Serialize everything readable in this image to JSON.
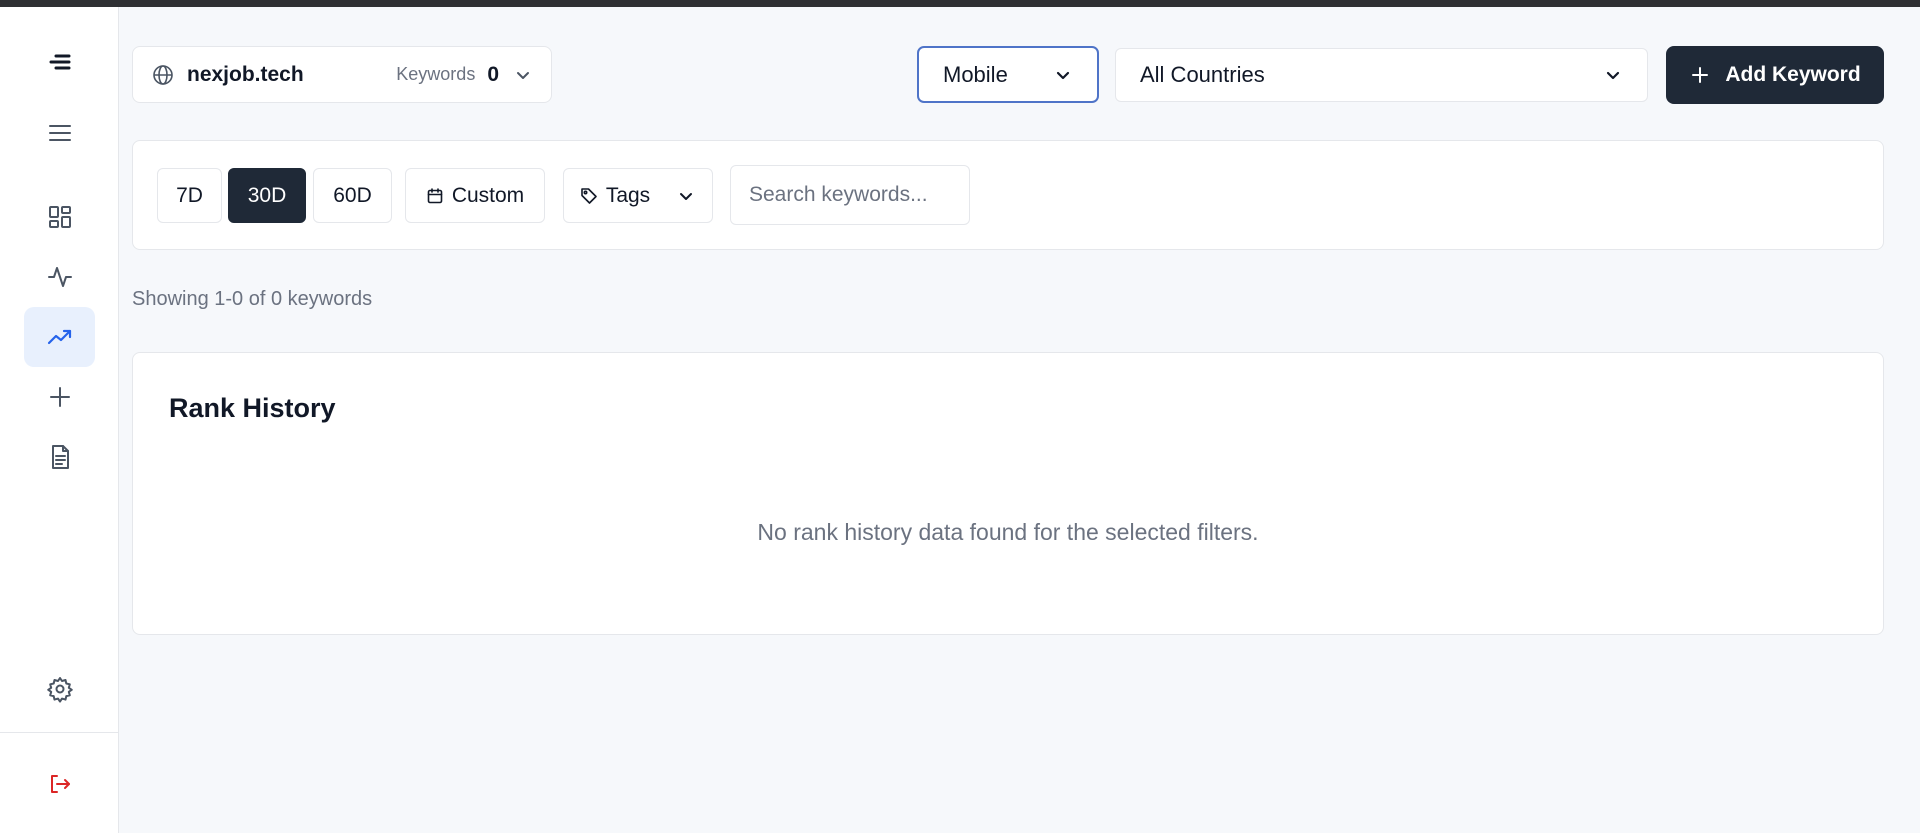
{
  "site": {
    "name": "nexjob.tech",
    "keywords_label": "Keywords",
    "keywords_count": "0"
  },
  "filters": {
    "device_selected": "Mobile",
    "country_selected": "All Countries",
    "add_keyword_label": "Add Keyword",
    "ranges": [
      "7D",
      "30D",
      "60D"
    ],
    "active_range": "30D",
    "custom_label": "Custom",
    "tags_label": "Tags",
    "search_placeholder": "Search keywords..."
  },
  "summary": {
    "showing_text": "Showing 1-0 of 0 keywords"
  },
  "rank_history": {
    "title": "Rank History",
    "empty_message": "No rank history data found for the selected filters."
  },
  "sidebar": {
    "items": [
      "logo",
      "menu",
      "dashboard",
      "activity",
      "rank-tracker",
      "add",
      "reports",
      "settings",
      "logout"
    ],
    "active": "rank-tracker",
    "accent_color": "#2563eb",
    "logout_color": "#dc2626"
  }
}
